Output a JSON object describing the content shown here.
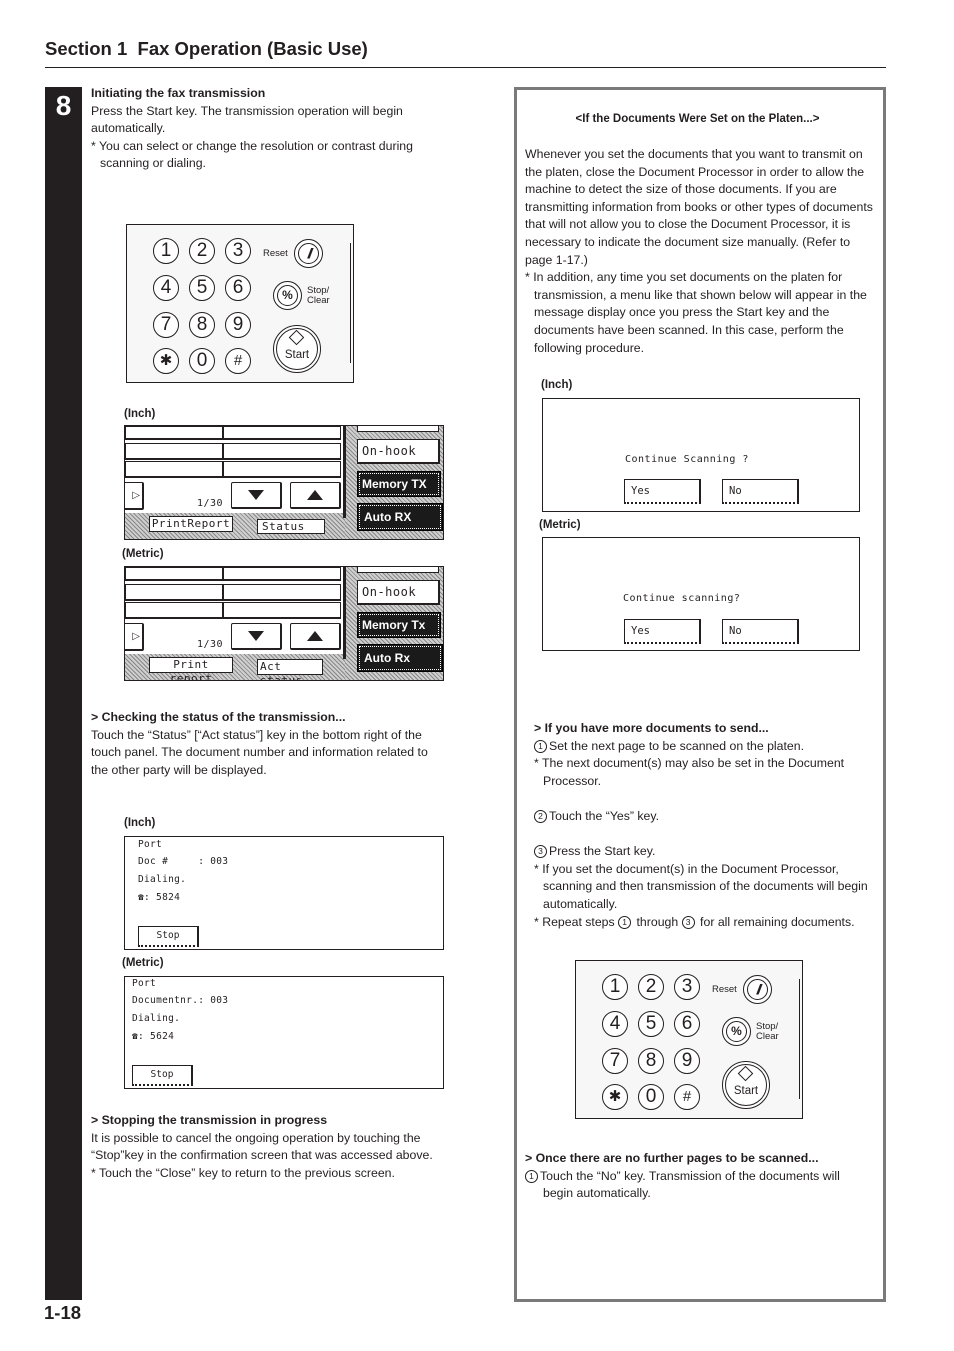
{
  "header": {
    "section_title": "Section 1  Fax Operation (Basic Use)"
  },
  "step": {
    "number": "8",
    "heading": "Initiating the fax transmission",
    "body": "Press the Start key. The transmission operation will begin automatically.",
    "note": "* You can select or change the resolution or contrast during scanning or dialing."
  },
  "keypad": {
    "keys": [
      "1",
      "2",
      "3",
      "4",
      "5",
      "6",
      "7",
      "8",
      "9",
      "✱",
      "0",
      "#"
    ],
    "reset_label": "Reset",
    "reset_glyph": "//",
    "stop_glyph": "%",
    "stop_label_1": "Stop/",
    "stop_label_2": "Clear",
    "start_label": "Start"
  },
  "touch_panels": [
    {
      "variant": "(Inch)",
      "page_counter": "1/30",
      "side_buttons": [
        "On-hook",
        "Memory TX",
        "Auto RX"
      ],
      "tabs": [
        "PrintReport",
        "Status"
      ]
    },
    {
      "variant": "(Metric)",
      "page_counter": "1/30",
      "side_buttons": [
        "On-hook",
        "Memory Tx",
        "Auto Rx"
      ],
      "tabs": [
        "Print report",
        "Act status"
      ]
    }
  ],
  "checking": {
    "heading": "> Checking the status of the transmission...",
    "body": "Touch the “Status” [“Act status”] key in the bottom right of the touch panel. The document number and information related to the other party will be displayed."
  },
  "status_screens": [
    {
      "variant": "(Inch)",
      "lines": [
        "Port",
        "Doc #     : 003",
        "Dialing.",
        "☎: 5824"
      ],
      "stop_button": "Stop"
    },
    {
      "variant": "(Metric)",
      "lines": [
        "Port",
        "Documentnr.: 003",
        "Dialing.",
        "☎: 5624"
      ],
      "stop_button": "Stop"
    }
  ],
  "stopping": {
    "heading": "> Stopping the transmission in progress",
    "body": "It is possible to cancel the ongoing operation by touching the “Stop”key in the confirmation screen that was accessed above.",
    "note": "* Touch the “Close” key to return to the previous screen."
  },
  "platen_box": {
    "heading": "<If the Documents Were Set on the Platen...>",
    "body": "Whenever you set the documents that you want to transmit on the platen, close the Document Processor in order to allow the machine to detect the size of those documents. If you are transmitting information from books or other types of documents that will not allow you to close the Document Processor, it is necessary to indicate the document size manually. (Refer to page 1-17.)",
    "note": "* In addition, any time you set documents on the platen for transmission, a menu like that shown below will appear in the message display once you press the Start key and the documents have been scanned. In this case, perform the following procedure.",
    "dialogs": [
      {
        "variant": "(Inch)",
        "prompt": "Continue Scanning ?",
        "yes": "Yes",
        "no": "No"
      },
      {
        "variant": "(Metric)",
        "prompt": "Continue scanning?",
        "yes": "Yes",
        "no": "No"
      }
    ],
    "more_docs": {
      "heading": "> If you have more documents to send...",
      "step1_num": "1",
      "step1": "Set the next page to be scanned on the platen.",
      "note1": "* The next document(s) may also be set in the Document Processor.",
      "step2_num": "2",
      "step2": "Touch the “Yes” key.",
      "step3_num": "3",
      "step3": "Press the Start key.",
      "note2": "* If you set the document(s) in the Document Processor, scanning and then transmission of the documents will begin automatically.",
      "note3_a": "* Repeat steps ",
      "note3_n1": "1",
      "note3_b": " through ",
      "note3_n3": "3",
      "note3_c": " for all remaining documents."
    },
    "no_more": {
      "heading": "> Once there are no further pages to be scanned...",
      "step1_num": "1",
      "step1": "Touch the “No” key. Transmission of the documents will begin automatically."
    }
  },
  "footer": {
    "page_number": "1-18"
  }
}
